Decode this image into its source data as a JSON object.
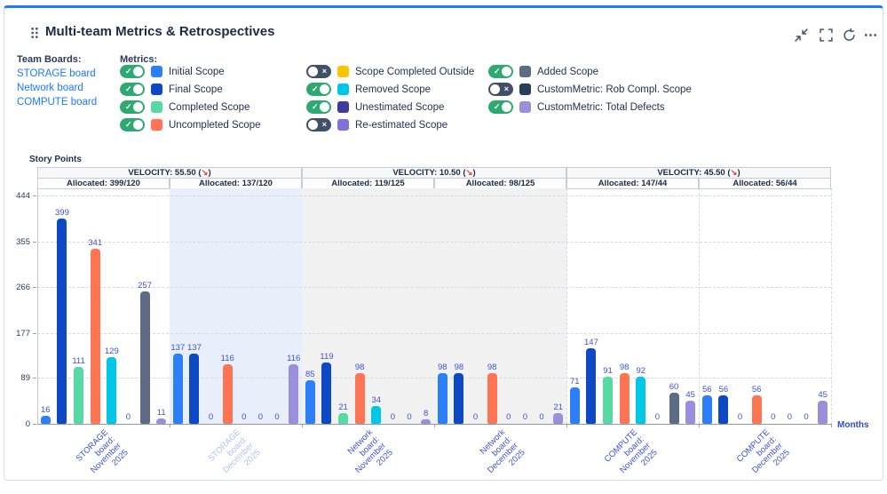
{
  "header": {
    "title": "Multi-team Metrics & Retrospectives"
  },
  "team_boards": {
    "label": "Team Boards:",
    "boards": [
      {
        "label": "STORAGE board"
      },
      {
        "label": "Network board"
      },
      {
        "label": "COMPUTE board"
      }
    ]
  },
  "metrics": {
    "label": "Metrics:",
    "items": [
      {
        "label": "Initial Scope",
        "color": "#2D7FF9",
        "enabled": true,
        "column": 0
      },
      {
        "label": "Final Scope",
        "color": "#0D49C4",
        "enabled": true,
        "column": 0
      },
      {
        "label": "Completed Scope",
        "color": "#57D9A3",
        "enabled": true,
        "column": 0
      },
      {
        "label": "Uncompleted Scope",
        "color": "#FF7452",
        "enabled": true,
        "column": 0
      },
      {
        "label": "Scope Completed Outside",
        "color": "#FFC400",
        "enabled": false,
        "column": 1
      },
      {
        "label": "Removed Scope",
        "color": "#00C7E6",
        "enabled": true,
        "column": 1
      },
      {
        "label": "Unestimated Scope",
        "color": "#3E3C96",
        "enabled": true,
        "column": 1
      },
      {
        "label": "Re-estimated Scope",
        "color": "#8270DB",
        "enabled": false,
        "column": 1
      },
      {
        "label": "Added Scope",
        "color": "#5D6C84",
        "enabled": true,
        "column": 2
      },
      {
        "label": "CustomMetric: Rob Compl. Scope",
        "color": "#2B3D5C",
        "enabled": false,
        "column": 2
      },
      {
        "label": "CustomMetric: Total Defects",
        "color": "#9A8FDB",
        "enabled": true,
        "column": 2
      }
    ]
  },
  "chart_data": {
    "type": "bar",
    "ylabel": "Story Points",
    "xlabel": "Months",
    "yticks": [
      0,
      89,
      177,
      266,
      355,
      444
    ],
    "ylim": [
      0,
      458
    ],
    "grid": true,
    "trend_arrow": "↘",
    "velocity_headers": [
      {
        "text": "VELOCITY: 55.50",
        "trend": "down"
      },
      {
        "text": "VELOCITY: 10.50",
        "trend": "down"
      },
      {
        "text": "VELOCITY: 45.50",
        "trend": "down"
      }
    ],
    "categories": [
      {
        "label": "STORAGE board: November 2025",
        "allocated": "Allocated: 399/120",
        "background": "#FFFFFF",
        "label_faded": false
      },
      {
        "label": "STORAGE board: December 2025",
        "allocated": "Allocated: 137/120",
        "background": "#E9EFFA",
        "label_faded": true
      },
      {
        "label": "Network board: November 2025",
        "allocated": "Allocated: 119/125",
        "background": "#F1F1F2",
        "label_faded": false
      },
      {
        "label": "Network board: December 2025",
        "allocated": "Allocated: 98/125",
        "background": "#F1F1F2",
        "label_faded": false
      },
      {
        "label": "COMPUTE board: November 2025",
        "allocated": "Allocated: 147/44",
        "background": "#FFFFFF",
        "label_faded": false
      },
      {
        "label": "COMPUTE board: December 2025",
        "allocated": "Allocated: 56/44",
        "background": "#FFFFFF",
        "label_faded": false
      }
    ],
    "series": [
      {
        "name": "Initial Scope",
        "color": "#2D7FF9",
        "values": [
          16,
          137,
          85,
          98,
          71,
          56
        ]
      },
      {
        "name": "Final Scope",
        "color": "#0D49C4",
        "values": [
          399,
          137,
          119,
          98,
          147,
          56
        ]
      },
      {
        "name": "Completed Scope",
        "color": "#57D9A3",
        "values": [
          111,
          0,
          21,
          0,
          91,
          0
        ]
      },
      {
        "name": "Uncompleted Scope",
        "color": "#FF7452",
        "values": [
          341,
          116,
          98,
          98,
          98,
          56
        ]
      },
      {
        "name": "Removed Scope",
        "color": "#00C7E6",
        "values": [
          129,
          0,
          34,
          0,
          92,
          0
        ]
      },
      {
        "name": "Unestimated Scope",
        "color": "#3E3C96",
        "values": [
          0,
          0,
          0,
          0,
          0,
          0
        ]
      },
      {
        "name": "Added Scope",
        "color": "#5D6C84",
        "values": [
          257,
          0,
          0,
          0,
          60,
          0
        ]
      },
      {
        "name": "CustomMetric: Total Defects",
        "color": "#9A8FDB",
        "values": [
          11,
          116,
          8,
          21,
          45,
          45
        ]
      }
    ]
  },
  "colors": {
    "accent_top_border": "#1D7AFC",
    "link_blue": "#1D7AFC",
    "value_label": "#3D52D5",
    "faded_label": "#AFC3F2",
    "trend_red": "#E2483D",
    "highlight_background": "#E9EFFA",
    "muted_background": "#F1F1F2",
    "toggle_on": "#2FA972",
    "toggle_off": "#405069"
  }
}
